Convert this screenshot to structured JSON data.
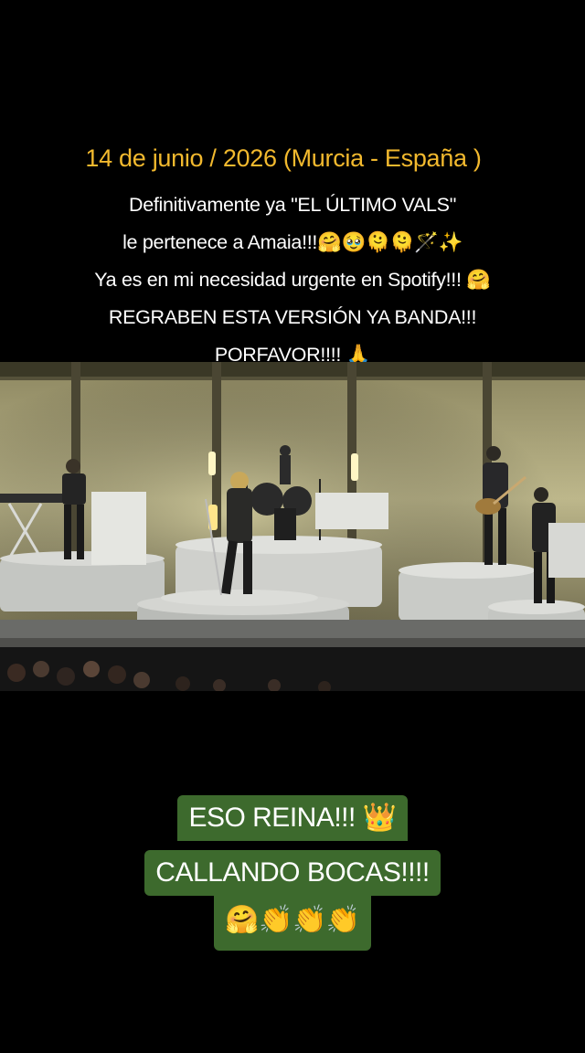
{
  "overlay": {
    "date_line": "14 de junio / 2026 (Murcia - España )",
    "caption_lines": [
      "Definitivamente ya \"EL ÚLTIMO VALS\"",
      "le pertenece a Amaia!!!🤗🥹🫠🫠🪄✨",
      "Ya es en mi necesidad urgente en Spotify!!! 🤗",
      "REGRABEN ESTA VERSIÓN YA BANDA!!!",
      "PORFAVOR!!!! 🙏"
    ]
  },
  "photo": {
    "subject": "concert-stage-photo",
    "colors": {
      "stage_wall": "#b9b386",
      "platform": "#c9cccc",
      "dark": "#151515"
    }
  },
  "sticker": {
    "lines": [
      "ESO REINA!!! 👑",
      "CALLANDO BOCAS!!!!",
      "🤗👏👏👏"
    ],
    "background": "#3d6a2d"
  }
}
